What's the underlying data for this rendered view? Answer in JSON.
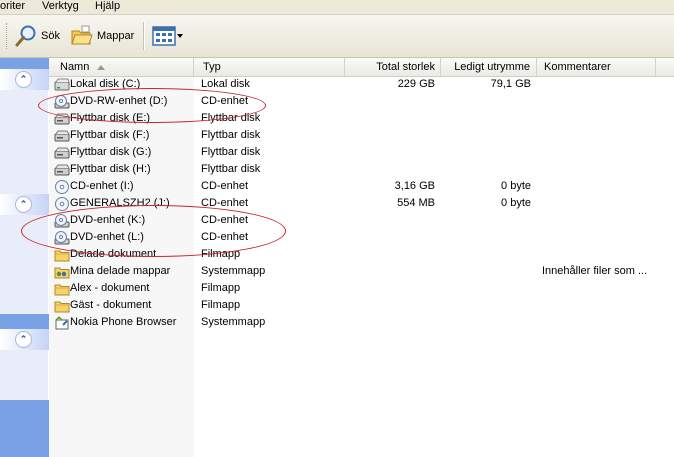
{
  "menu": {
    "favorites_partial": "oriter",
    "tools": "Verktyg",
    "help": "Hjälp"
  },
  "toolbar": {
    "search_label": "Sök",
    "folders_label": "Mappar"
  },
  "columns": {
    "name": "Namn",
    "type": "Typ",
    "total_size": "Total storlek",
    "free_space": "Ledigt utrymme",
    "comments": "Kommentarer"
  },
  "rows": [
    {
      "name": "Lokal disk (C:)",
      "type": "Lokal disk",
      "total": "229 GB",
      "free": "79,1 GB",
      "comment": "",
      "icon": "hard-disk-icon"
    },
    {
      "name": "DVD-RW-enhet (D:)",
      "type": "CD-enhet",
      "total": "",
      "free": "",
      "comment": "",
      "icon": "dvd-drive-icon"
    },
    {
      "name": "Flyttbar disk (E:)",
      "type": "Flyttbar disk",
      "total": "",
      "free": "",
      "comment": "",
      "icon": "removable-disk-icon"
    },
    {
      "name": "Flyttbar disk (F:)",
      "type": "Flyttbar disk",
      "total": "",
      "free": "",
      "comment": "",
      "icon": "removable-disk-icon"
    },
    {
      "name": "Flyttbar disk (G:)",
      "type": "Flyttbar disk",
      "total": "",
      "free": "",
      "comment": "",
      "icon": "removable-disk-icon"
    },
    {
      "name": "Flyttbar disk (H:)",
      "type": "Flyttbar disk",
      "total": "",
      "free": "",
      "comment": "",
      "icon": "removable-disk-icon"
    },
    {
      "name": "CD-enhet (I:)",
      "type": "CD-enhet",
      "total": "3,16 GB",
      "free": "0 byte",
      "comment": "",
      "icon": "cd-drive-icon"
    },
    {
      "name": "GENERALSZH2 (J:)",
      "type": "CD-enhet",
      "total": "554 MB",
      "free": "0 byte",
      "comment": "",
      "icon": "cd-drive-icon"
    },
    {
      "name": "DVD-enhet (K:)",
      "type": "CD-enhet",
      "total": "",
      "free": "",
      "comment": "",
      "icon": "dvd-drive-icon"
    },
    {
      "name": "DVD-enhet (L:)",
      "type": "CD-enhet",
      "total": "",
      "free": "",
      "comment": "",
      "icon": "dvd-drive-icon"
    },
    {
      "name": "Delade dokument",
      "type": "Filmapp",
      "total": "",
      "free": "",
      "comment": "",
      "icon": "folder-icon"
    },
    {
      "name": "Mina delade mappar",
      "type": "Systemmapp",
      "total": "",
      "free": "",
      "comment": "Innehåller filer som ...",
      "icon": "shared-folder-icon"
    },
    {
      "name": "Alex - dokument",
      "type": "Filmapp",
      "total": "",
      "free": "",
      "comment": "",
      "icon": "folder-icon"
    },
    {
      "name": "Gäst - dokument",
      "type": "Filmapp",
      "total": "",
      "free": "",
      "comment": "",
      "icon": "folder-icon"
    },
    {
      "name": "Nokia Phone Browser",
      "type": "Systemmapp",
      "total": "",
      "free": "",
      "comment": "",
      "icon": "phone-browser-icon"
    }
  ],
  "colors": {
    "annotation": "#c8262e",
    "taskpane": "#7aa1e6"
  }
}
